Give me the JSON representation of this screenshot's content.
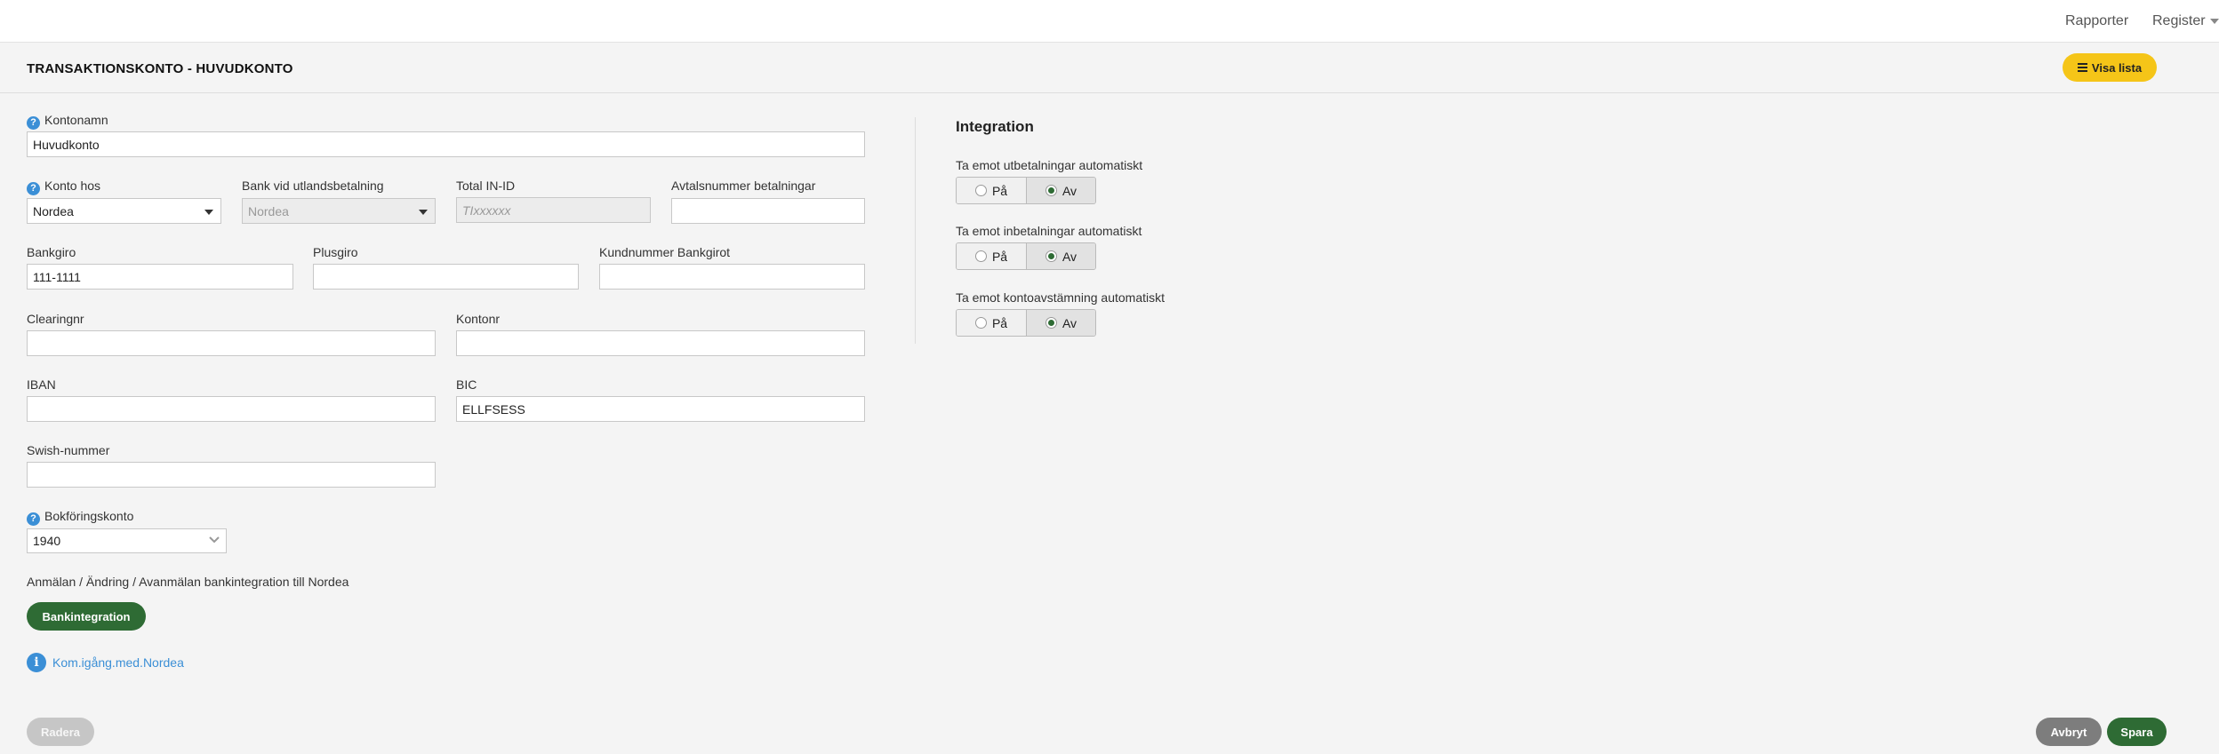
{
  "topnav": {
    "rapporter": "Rapporter",
    "register": "Register"
  },
  "header": {
    "title": "TRANSAKTIONSKONTO - HUVUDKONTO",
    "visa_lista": "Visa lista"
  },
  "form": {
    "kontonamn": {
      "label": "Kontonamn",
      "value": "Huvudkonto"
    },
    "konto_hos": {
      "label": "Konto hos",
      "value": "Nordea"
    },
    "bank_utland": {
      "label": "Bank vid utlandsbetalning",
      "value": "Nordea"
    },
    "total_in_id": {
      "label": "Total IN-ID",
      "placeholder": "TIxxxxxx"
    },
    "avtalsnummer": {
      "label": "Avtalsnummer betalningar",
      "value": ""
    },
    "bankgiro": {
      "label": "Bankgiro",
      "value": "111-1111"
    },
    "plusgiro": {
      "label": "Plusgiro",
      "value": ""
    },
    "kundnummer": {
      "label": "Kundnummer Bankgirot",
      "value": ""
    },
    "clearingnr": {
      "label": "Clearingnr",
      "value": ""
    },
    "kontonr": {
      "label": "Kontonr",
      "value": ""
    },
    "iban": {
      "label": "IBAN",
      "value": ""
    },
    "bic": {
      "label": "BIC",
      "value": "ELLFSESS"
    },
    "swish": {
      "label": "Swish-nummer",
      "value": ""
    },
    "bokforingskonto": {
      "label": "Bokföringskonto",
      "value": "1940"
    },
    "bankintegration_text": "Anmälan / Ändring / Avanmälan bankintegration till Nordea",
    "bankintegration_button": "Bankintegration",
    "info_link": "Kom.igång.med.Nordea"
  },
  "integration": {
    "title": "Integration",
    "groups": [
      {
        "label": "Ta emot utbetalningar automatiskt",
        "options": [
          "På",
          "Av"
        ],
        "selected": "Av"
      },
      {
        "label": "Ta emot inbetalningar automatiskt",
        "options": [
          "På",
          "Av"
        ],
        "selected": "Av"
      },
      {
        "label": "Ta emot kontoavstämning automatiskt",
        "options": [
          "På",
          "Av"
        ],
        "selected": "Av"
      }
    ]
  },
  "footer": {
    "radera": "Radera",
    "avbryt": "Avbryt",
    "spara": "Spara"
  },
  "colors": {
    "primary_green": "#2e6b34",
    "accent_yellow": "#f5c518",
    "link_blue": "#3b8fd6"
  }
}
